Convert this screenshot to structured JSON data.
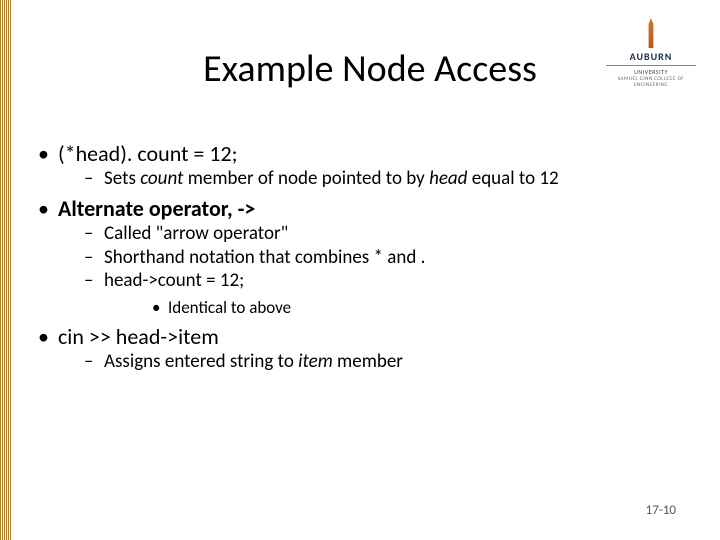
{
  "brand": {
    "name": "AUBURN",
    "subtitle": "UNIVERSITY",
    "college": "SAMUEL GINN COLLEGE OF ENGINEERING"
  },
  "title": "Example Node Access",
  "bullets": {
    "b1": "(*head). count = 12;",
    "b1_1a": "Sets ",
    "b1_1_count": "count",
    "b1_1b": " member of node pointed to by ",
    "b1_1_head": "head",
    "b1_1c": " equal to 12",
    "b2": "Alternate operator, ->",
    "b2_1": "Called \"arrow operator\"",
    "b2_2": "Shorthand notation that combines * and .",
    "b2_3": "head->count = 12;",
    "b2_3_1": "Identical to above",
    "b3": "cin >> head->item",
    "b3_1a": "Assigns entered string to ",
    "b3_1_item": "item",
    "b3_1b": " member"
  },
  "slide_number": "17-10"
}
